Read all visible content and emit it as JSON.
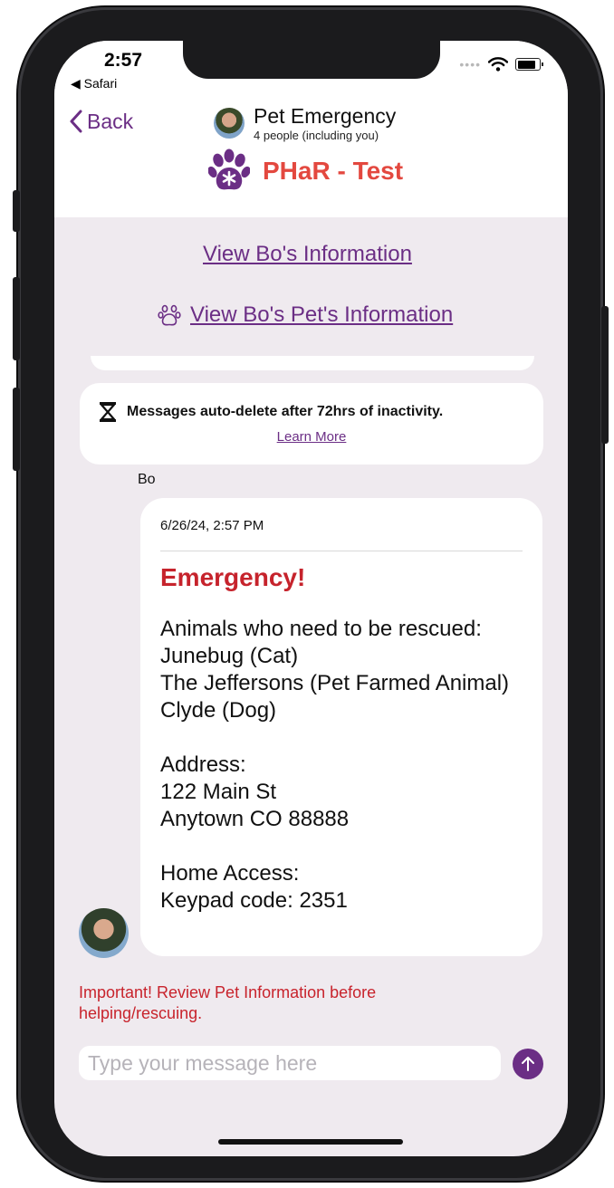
{
  "status_bar": {
    "time": "2:57",
    "back_app": "◀ Safari"
  },
  "nav": {
    "back_label": "Back",
    "chat_title": "Pet Emergency",
    "chat_subtitle": "4 people (including you)",
    "brand": "PHaR - Test"
  },
  "links": {
    "view_info": "View Bo's Information",
    "view_pet_info": "View Bo's Pet's Information"
  },
  "notice": {
    "text": "Messages auto-delete after 72hrs of inactivity.",
    "link": "Learn More"
  },
  "message": {
    "sender": "Bo",
    "timestamp": "6/26/24, 2:57 PM",
    "heading": "Emergency!",
    "lines": [
      "Animals who need to be rescued:",
      "Junebug (Cat)",
      "The Jeffersons (Pet Farmed Animal)",
      "Clyde (Dog)",
      "",
      "Address:",
      "122 Main St",
      "Anytown CO 88888",
      "",
      "Home Access:",
      "Keypad code: 2351"
    ]
  },
  "warning": "Important! Review Pet Information before helping/rescuing.",
  "composer": {
    "placeholder": "Type your message here"
  },
  "colors": {
    "brand_purple": "#6b2e85",
    "alert_red": "#c6232c",
    "brand_red": "#e3483f",
    "background": "#efeaef"
  }
}
